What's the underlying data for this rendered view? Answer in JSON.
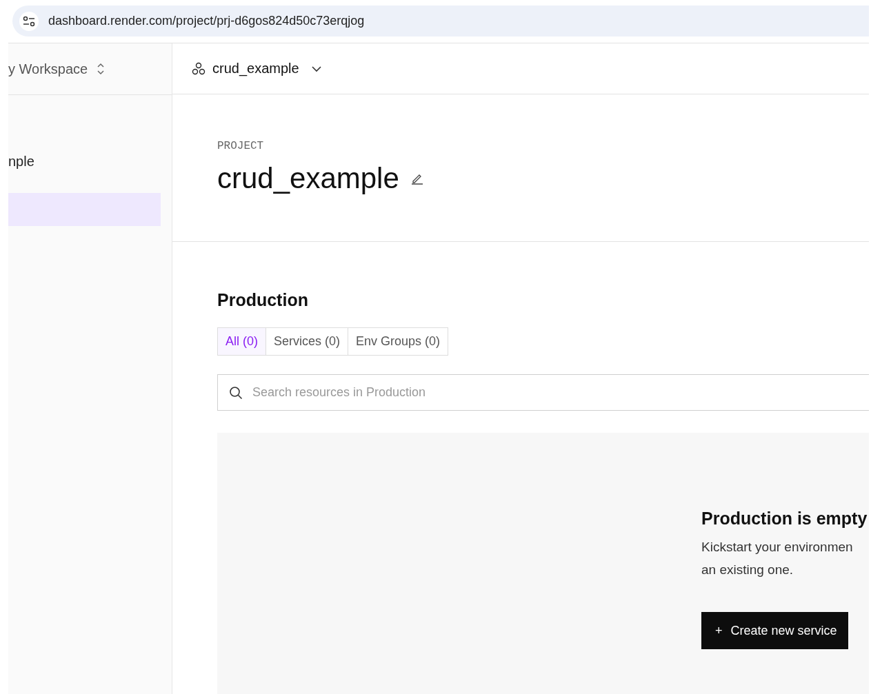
{
  "address_bar": {
    "url": "dashboard.render.com/project/prj-d6gos824d50c73erqjog"
  },
  "sidebar": {
    "workspace": "y Workspace",
    "items": [
      {
        "label": "nple",
        "selected": false
      },
      {
        "selected": true
      }
    ]
  },
  "project_selector": {
    "label": "crud_example"
  },
  "header": {
    "eyebrow": "PROJECT",
    "title": "crud_example"
  },
  "environment": {
    "title": "Production",
    "tabs": [
      {
        "label": "All (0)",
        "selected": true
      },
      {
        "label": "Services (0)",
        "selected": false
      },
      {
        "label": "Env Groups (0)",
        "selected": false
      }
    ],
    "search": {
      "placeholder": "Search resources in Production"
    },
    "empty_state": {
      "title": "Production is empty",
      "text_lines": [
        "Kickstart your environmen",
        "an existing one."
      ],
      "button": {
        "icon": "+",
        "label": "Create new service"
      }
    }
  }
}
